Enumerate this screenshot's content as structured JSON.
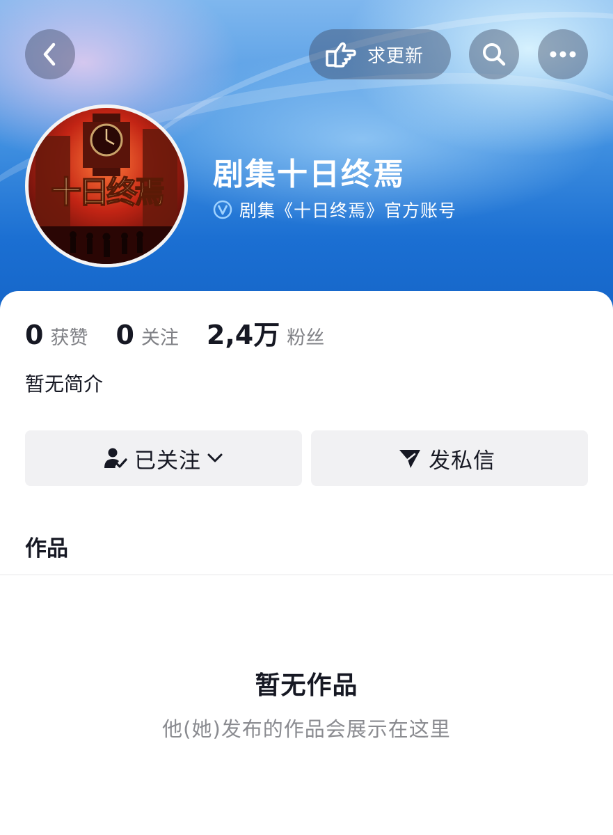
{
  "header": {
    "request_update_label": "求更新",
    "back_icon": "chevron-left-icon",
    "search_icon": "search-icon",
    "more_icon": "more-dots-icon",
    "pointing_hand_icon": "pointing-hand-icon"
  },
  "profile": {
    "name": "剧集十日终焉",
    "verified_text": "剧集《十日终焉》官方账号",
    "avatar_text": "十日终焉",
    "verified_icon": "verified-badge-icon"
  },
  "stats": [
    {
      "value": "0",
      "label": "获赞"
    },
    {
      "value": "0",
      "label": "关注"
    },
    {
      "value": "2,4万",
      "label": "粉丝"
    }
  ],
  "bio": "暂无简介",
  "actions": {
    "follow_label": "已关注",
    "message_label": "发私信"
  },
  "tabs": {
    "works_label": "作品"
  },
  "empty_state": {
    "title": "暂无作品",
    "subtitle": "他(她)发布的作品会展示在这里"
  },
  "colors": {
    "banner_blue": "#1b6fd2",
    "text_primary": "#161823",
    "text_secondary": "#7f8085",
    "button_bg": "#f1f1f3"
  }
}
